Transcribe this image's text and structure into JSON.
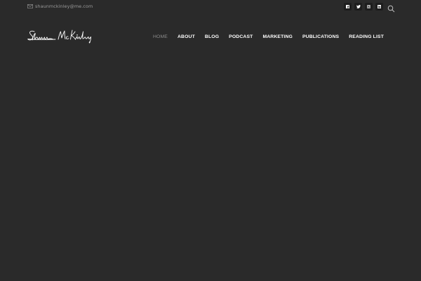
{
  "topbar": {
    "email": "shaunmckinley@me.com",
    "social": [
      {
        "name": "facebook",
        "icon": "facebook-icon"
      },
      {
        "name": "twitter",
        "icon": "twitter-icon"
      },
      {
        "name": "instagram",
        "icon": "instagram-icon"
      },
      {
        "name": "linkedin",
        "icon": "linkedin-icon"
      }
    ],
    "search_icon": "search-icon"
  },
  "header": {
    "logo_text": "Shaun McKinley"
  },
  "nav": {
    "items": [
      {
        "label": "HOME",
        "active": true
      },
      {
        "label": "ABOUT",
        "active": false
      },
      {
        "label": "BLOG",
        "active": false
      },
      {
        "label": "PODCAST",
        "active": false
      },
      {
        "label": "MARKETING",
        "active": false
      },
      {
        "label": "PUBLICATIONS",
        "active": false
      },
      {
        "label": "READING LIST",
        "active": false
      }
    ]
  },
  "colors": {
    "background": "#2a2a2a",
    "nav_text": "#ffffff",
    "nav_active": "#8c8c8c",
    "muted_text": "#9a9a9a",
    "social_bg": "#1d1d1d"
  }
}
